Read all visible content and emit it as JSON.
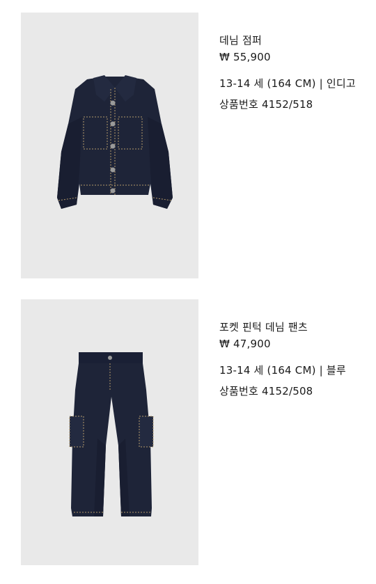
{
  "products": [
    {
      "name": "데님 점퍼",
      "price": "₩ 55,900",
      "size_color": "13-14 세 (164 CM) | 인디고",
      "sku": "상품번호 4152/518",
      "image_icon": "denim-jacket-image"
    },
    {
      "name": "포켓 핀턱 데님 팬츠",
      "price": "₩ 47,900",
      "size_color": "13-14 세 (164 CM) | 블루",
      "sku": "상품번호 4152/508",
      "image_icon": "denim-pants-image"
    }
  ],
  "colors": {
    "photo_bg": "#e9e9e9",
    "denim": "#1e2438",
    "stitch": "#b49a6a"
  }
}
